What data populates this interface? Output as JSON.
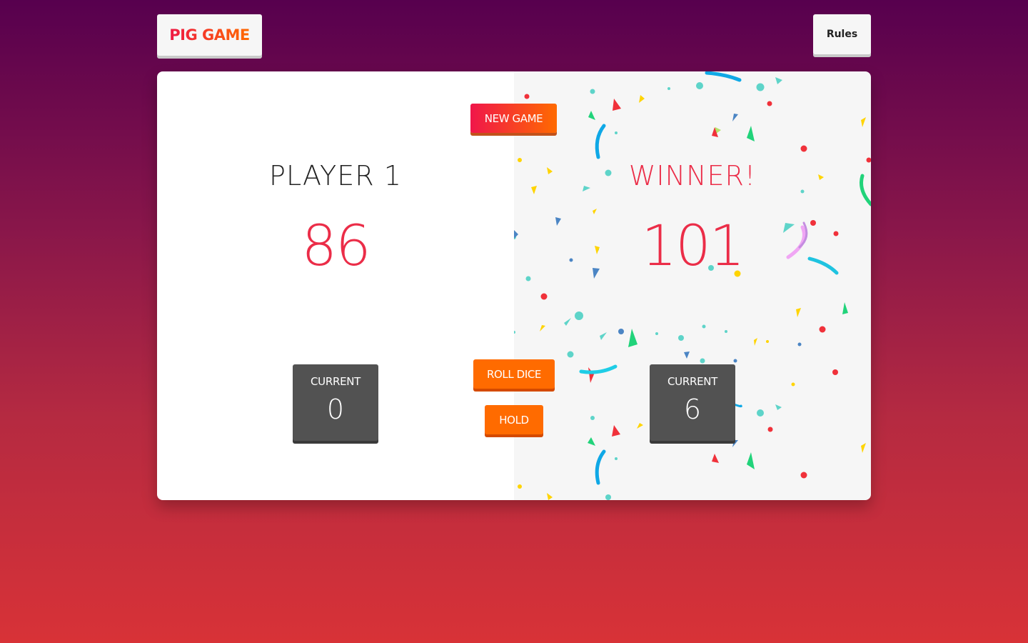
{
  "header": {
    "logo_label": "PIG GAME",
    "rules_label": "Rules"
  },
  "players": [
    {
      "name": "PLAYER 1",
      "score": "86",
      "current_label": "CURRENT",
      "current_value": "0",
      "is_winner": false
    },
    {
      "name": "WINNER!",
      "score": "101",
      "current_label": "CURRENT",
      "current_value": "6",
      "is_winner": true
    }
  ],
  "actions": {
    "new_game_label": "NEW GAME",
    "roll_dice_label": "ROLL DICE",
    "hold_label": "HOLD"
  },
  "colors": {
    "accent": "#ff6b00",
    "score": "#eb2d48",
    "gradient_top": "#57004e",
    "gradient_bottom": "#d83237",
    "current_box": "#525252"
  }
}
